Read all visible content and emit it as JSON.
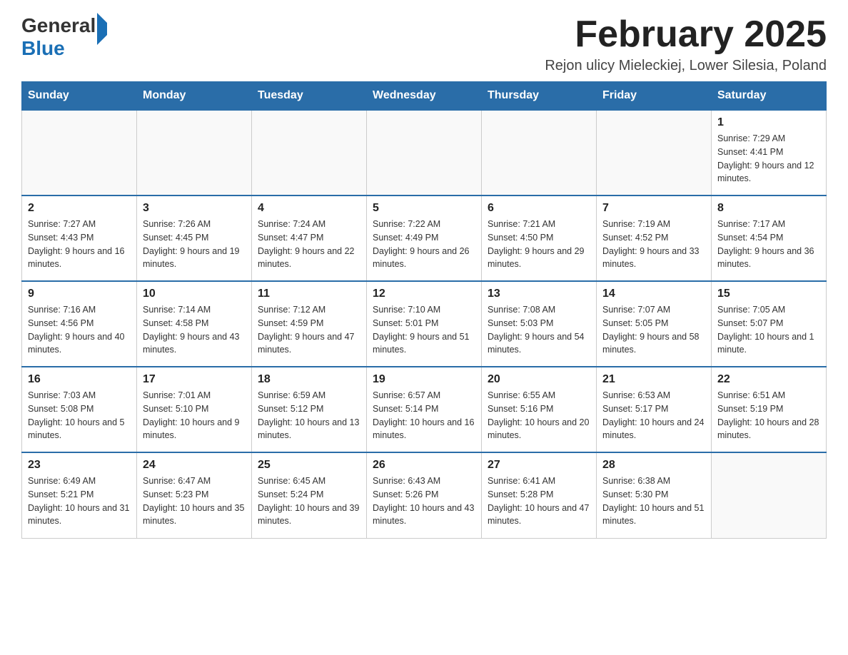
{
  "logo": {
    "general": "General",
    "blue": "Blue"
  },
  "header": {
    "title": "February 2025",
    "subtitle": "Rejon ulicy Mieleckiej, Lower Silesia, Poland"
  },
  "weekdays": [
    "Sunday",
    "Monday",
    "Tuesday",
    "Wednesday",
    "Thursday",
    "Friday",
    "Saturday"
  ],
  "weeks": [
    [
      {
        "day": "",
        "info": ""
      },
      {
        "day": "",
        "info": ""
      },
      {
        "day": "",
        "info": ""
      },
      {
        "day": "",
        "info": ""
      },
      {
        "day": "",
        "info": ""
      },
      {
        "day": "",
        "info": ""
      },
      {
        "day": "1",
        "info": "Sunrise: 7:29 AM\nSunset: 4:41 PM\nDaylight: 9 hours and 12 minutes."
      }
    ],
    [
      {
        "day": "2",
        "info": "Sunrise: 7:27 AM\nSunset: 4:43 PM\nDaylight: 9 hours and 16 minutes."
      },
      {
        "day": "3",
        "info": "Sunrise: 7:26 AM\nSunset: 4:45 PM\nDaylight: 9 hours and 19 minutes."
      },
      {
        "day": "4",
        "info": "Sunrise: 7:24 AM\nSunset: 4:47 PM\nDaylight: 9 hours and 22 minutes."
      },
      {
        "day": "5",
        "info": "Sunrise: 7:22 AM\nSunset: 4:49 PM\nDaylight: 9 hours and 26 minutes."
      },
      {
        "day": "6",
        "info": "Sunrise: 7:21 AM\nSunset: 4:50 PM\nDaylight: 9 hours and 29 minutes."
      },
      {
        "day": "7",
        "info": "Sunrise: 7:19 AM\nSunset: 4:52 PM\nDaylight: 9 hours and 33 minutes."
      },
      {
        "day": "8",
        "info": "Sunrise: 7:17 AM\nSunset: 4:54 PM\nDaylight: 9 hours and 36 minutes."
      }
    ],
    [
      {
        "day": "9",
        "info": "Sunrise: 7:16 AM\nSunset: 4:56 PM\nDaylight: 9 hours and 40 minutes."
      },
      {
        "day": "10",
        "info": "Sunrise: 7:14 AM\nSunset: 4:58 PM\nDaylight: 9 hours and 43 minutes."
      },
      {
        "day": "11",
        "info": "Sunrise: 7:12 AM\nSunset: 4:59 PM\nDaylight: 9 hours and 47 minutes."
      },
      {
        "day": "12",
        "info": "Sunrise: 7:10 AM\nSunset: 5:01 PM\nDaylight: 9 hours and 51 minutes."
      },
      {
        "day": "13",
        "info": "Sunrise: 7:08 AM\nSunset: 5:03 PM\nDaylight: 9 hours and 54 minutes."
      },
      {
        "day": "14",
        "info": "Sunrise: 7:07 AM\nSunset: 5:05 PM\nDaylight: 9 hours and 58 minutes."
      },
      {
        "day": "15",
        "info": "Sunrise: 7:05 AM\nSunset: 5:07 PM\nDaylight: 10 hours and 1 minute."
      }
    ],
    [
      {
        "day": "16",
        "info": "Sunrise: 7:03 AM\nSunset: 5:08 PM\nDaylight: 10 hours and 5 minutes."
      },
      {
        "day": "17",
        "info": "Sunrise: 7:01 AM\nSunset: 5:10 PM\nDaylight: 10 hours and 9 minutes."
      },
      {
        "day": "18",
        "info": "Sunrise: 6:59 AM\nSunset: 5:12 PM\nDaylight: 10 hours and 13 minutes."
      },
      {
        "day": "19",
        "info": "Sunrise: 6:57 AM\nSunset: 5:14 PM\nDaylight: 10 hours and 16 minutes."
      },
      {
        "day": "20",
        "info": "Sunrise: 6:55 AM\nSunset: 5:16 PM\nDaylight: 10 hours and 20 minutes."
      },
      {
        "day": "21",
        "info": "Sunrise: 6:53 AM\nSunset: 5:17 PM\nDaylight: 10 hours and 24 minutes."
      },
      {
        "day": "22",
        "info": "Sunrise: 6:51 AM\nSunset: 5:19 PM\nDaylight: 10 hours and 28 minutes."
      }
    ],
    [
      {
        "day": "23",
        "info": "Sunrise: 6:49 AM\nSunset: 5:21 PM\nDaylight: 10 hours and 31 minutes."
      },
      {
        "day": "24",
        "info": "Sunrise: 6:47 AM\nSunset: 5:23 PM\nDaylight: 10 hours and 35 minutes."
      },
      {
        "day": "25",
        "info": "Sunrise: 6:45 AM\nSunset: 5:24 PM\nDaylight: 10 hours and 39 minutes."
      },
      {
        "day": "26",
        "info": "Sunrise: 6:43 AM\nSunset: 5:26 PM\nDaylight: 10 hours and 43 minutes."
      },
      {
        "day": "27",
        "info": "Sunrise: 6:41 AM\nSunset: 5:28 PM\nDaylight: 10 hours and 47 minutes."
      },
      {
        "day": "28",
        "info": "Sunrise: 6:38 AM\nSunset: 5:30 PM\nDaylight: 10 hours and 51 minutes."
      },
      {
        "day": "",
        "info": ""
      }
    ]
  ]
}
